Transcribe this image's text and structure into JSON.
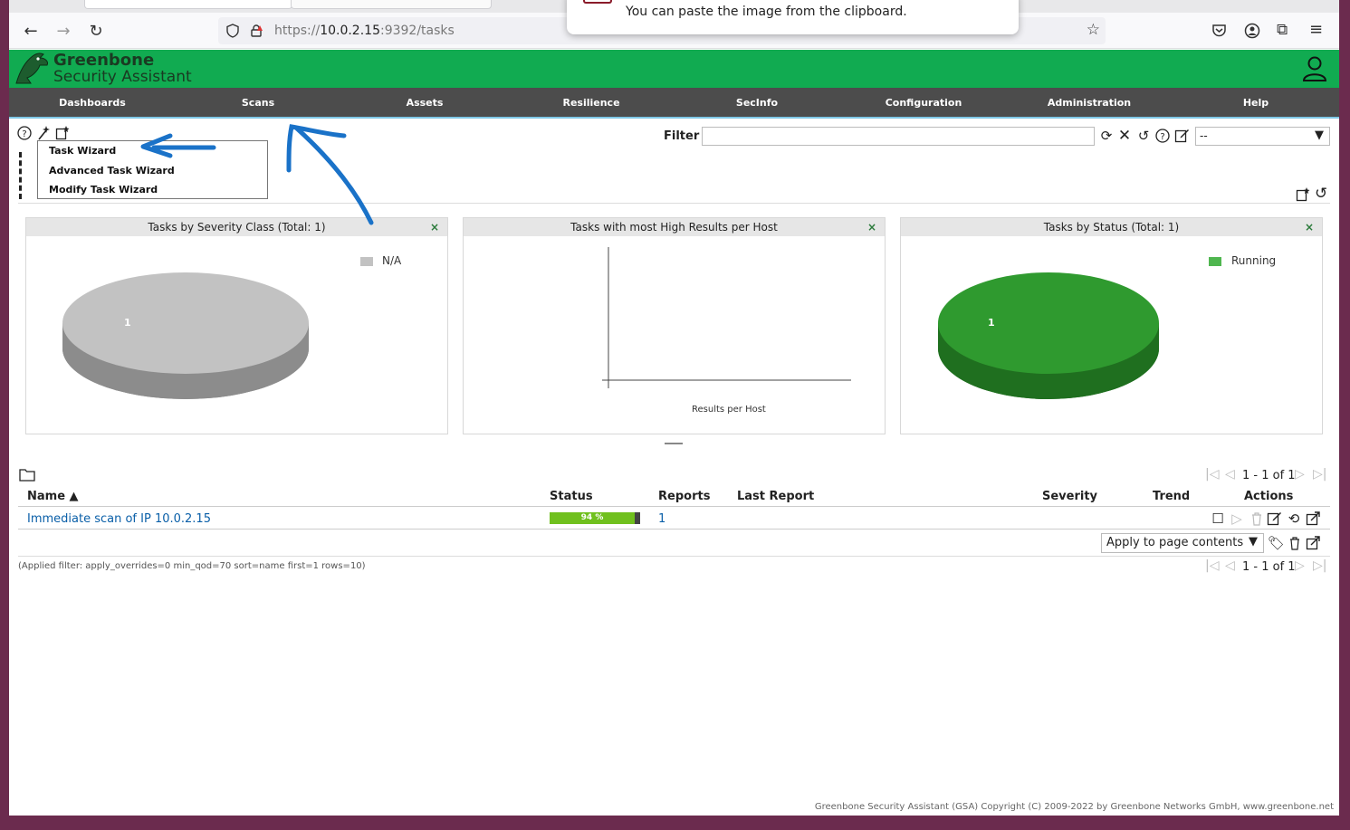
{
  "browser": {
    "url_host": "10.0.2.15",
    "url_rest": ":9392/tasks",
    "url_prefix": "https://",
    "popup_text": "You can paste the image from the clipboard."
  },
  "app": {
    "brand_line1": "Greenbone",
    "brand_line2": "Security Assistant",
    "accent": "#11ab51",
    "menu_bg": "#4c4c4c"
  },
  "menu": [
    "Dashboards",
    "Scans",
    "Assets",
    "Resilience",
    "SecInfo",
    "Configuration",
    "Administration",
    "Help"
  ],
  "filter": {
    "label": "Filter",
    "value": "",
    "selected": "--"
  },
  "wizard_menu": [
    "Task Wizard",
    "Advanced Task Wizard",
    "Modify Task Wizard"
  ],
  "panels": [
    {
      "title": "Tasks by Severity Class (Total: 1)",
      "legend": "N/A",
      "slice_label": "1",
      "color": "#c2c2c2"
    },
    {
      "title": "Tasks with most High Results per Host",
      "xlabel": "Results per Host"
    },
    {
      "title": "Tasks by Status (Total: 1)",
      "legend": "Running",
      "slice_label": "1",
      "color": "#3aa13a"
    }
  ],
  "table": {
    "headers": {
      "name": "Name ▲",
      "status": "Status",
      "reports": "Reports",
      "last_report": "Last Report",
      "severity": "Severity",
      "trend": "Trend",
      "actions": "Actions"
    },
    "rows": [
      {
        "name": "Immediate scan of IP 10.0.2.15",
        "status_text": "94 %",
        "progress": 94,
        "reports": "1"
      }
    ],
    "pager": "1 - 1 of 1",
    "apply_label": "Apply to page contents",
    "applied_filter": "(Applied filter: apply_overrides=0 min_qod=70 sort=name first=1 rows=10)"
  },
  "footer": "Greenbone Security Assistant (GSA) Copyright (C) 2009-2022 by Greenbone Networks GmbH, www.greenbone.net"
}
